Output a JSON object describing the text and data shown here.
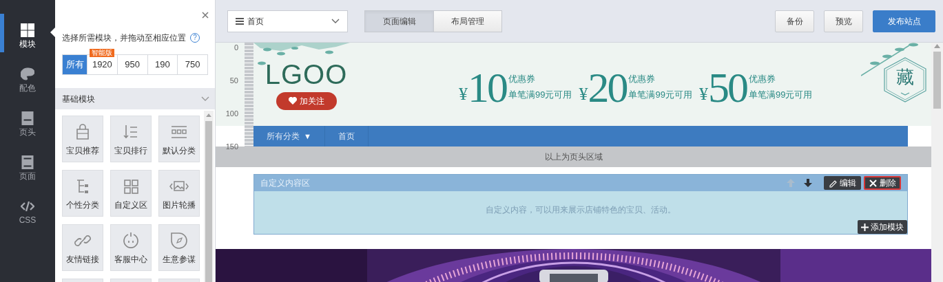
{
  "sidebar": {
    "items": [
      {
        "label": "模块",
        "selected": true
      },
      {
        "label": "配色",
        "selected": false
      },
      {
        "label": "页头",
        "selected": false
      },
      {
        "label": "页面",
        "selected": false
      },
      {
        "label": "CSS",
        "selected": false
      }
    ]
  },
  "panel": {
    "hint": "选择所需模块，并拖动至相应位置",
    "help": "?",
    "filters": [
      {
        "label": "所有",
        "selected": true
      },
      {
        "label": "1920",
        "selected": false,
        "badge": "智能版"
      },
      {
        "label": "950",
        "selected": false
      },
      {
        "label": "190",
        "selected": false
      },
      {
        "label": "750",
        "selected": false
      }
    ],
    "section": {
      "title": "基础模块",
      "expanded": true
    },
    "modules": [
      {
        "label": "宝贝推荐"
      },
      {
        "label": "宝贝排行"
      },
      {
        "label": "默认分类"
      },
      {
        "label": "个性分类"
      },
      {
        "label": "自定义区"
      },
      {
        "label": "图片轮播"
      },
      {
        "label": "友情链接"
      },
      {
        "label": "客服中心"
      },
      {
        "label": "生意参谋"
      }
    ]
  },
  "toolbar": {
    "page_select": "首页",
    "modes": [
      {
        "label": "页面编辑",
        "selected": true
      },
      {
        "label": "布局管理",
        "selected": false
      }
    ],
    "buttons": [
      {
        "label": "备份",
        "kind": "default"
      },
      {
        "label": "预览",
        "kind": "default"
      },
      {
        "label": "发布站点",
        "kind": "primary"
      }
    ]
  },
  "ruler": {
    "ticks": [
      "0",
      "50",
      "100",
      "150"
    ]
  },
  "shop_header": {
    "logo": "LGOO",
    "follow": "加关注",
    "coupons": [
      {
        "currency": "¥",
        "amount": "10",
        "title": "优惠券",
        "condition": "单笔满99元可用"
      },
      {
        "currency": "¥",
        "amount": "20",
        "title": "优惠券",
        "condition": "单笔满99元可用"
      },
      {
        "currency": "¥",
        "amount": "50",
        "title": "优惠券",
        "condition": "单笔满99元可用"
      }
    ],
    "favorite": "藏",
    "nav": [
      {
        "label": "所有分类",
        "caret": "▼"
      },
      {
        "label": "首页"
      }
    ]
  },
  "header_divider": "以上为页头区域",
  "custom_module": {
    "title": "自定义内容区",
    "move_buttons": [
      {
        "kind": "up",
        "disabled": true
      },
      {
        "kind": "down",
        "disabled": false
      }
    ],
    "actions": [
      {
        "label": "编辑",
        "kind": "edit",
        "highlighted": false
      },
      {
        "label": "删除",
        "kind": "delete",
        "highlighted": true
      }
    ],
    "body": "自定义内容，可以用来展示店铺特色的宝贝、活动。",
    "add": "添加模块"
  }
}
